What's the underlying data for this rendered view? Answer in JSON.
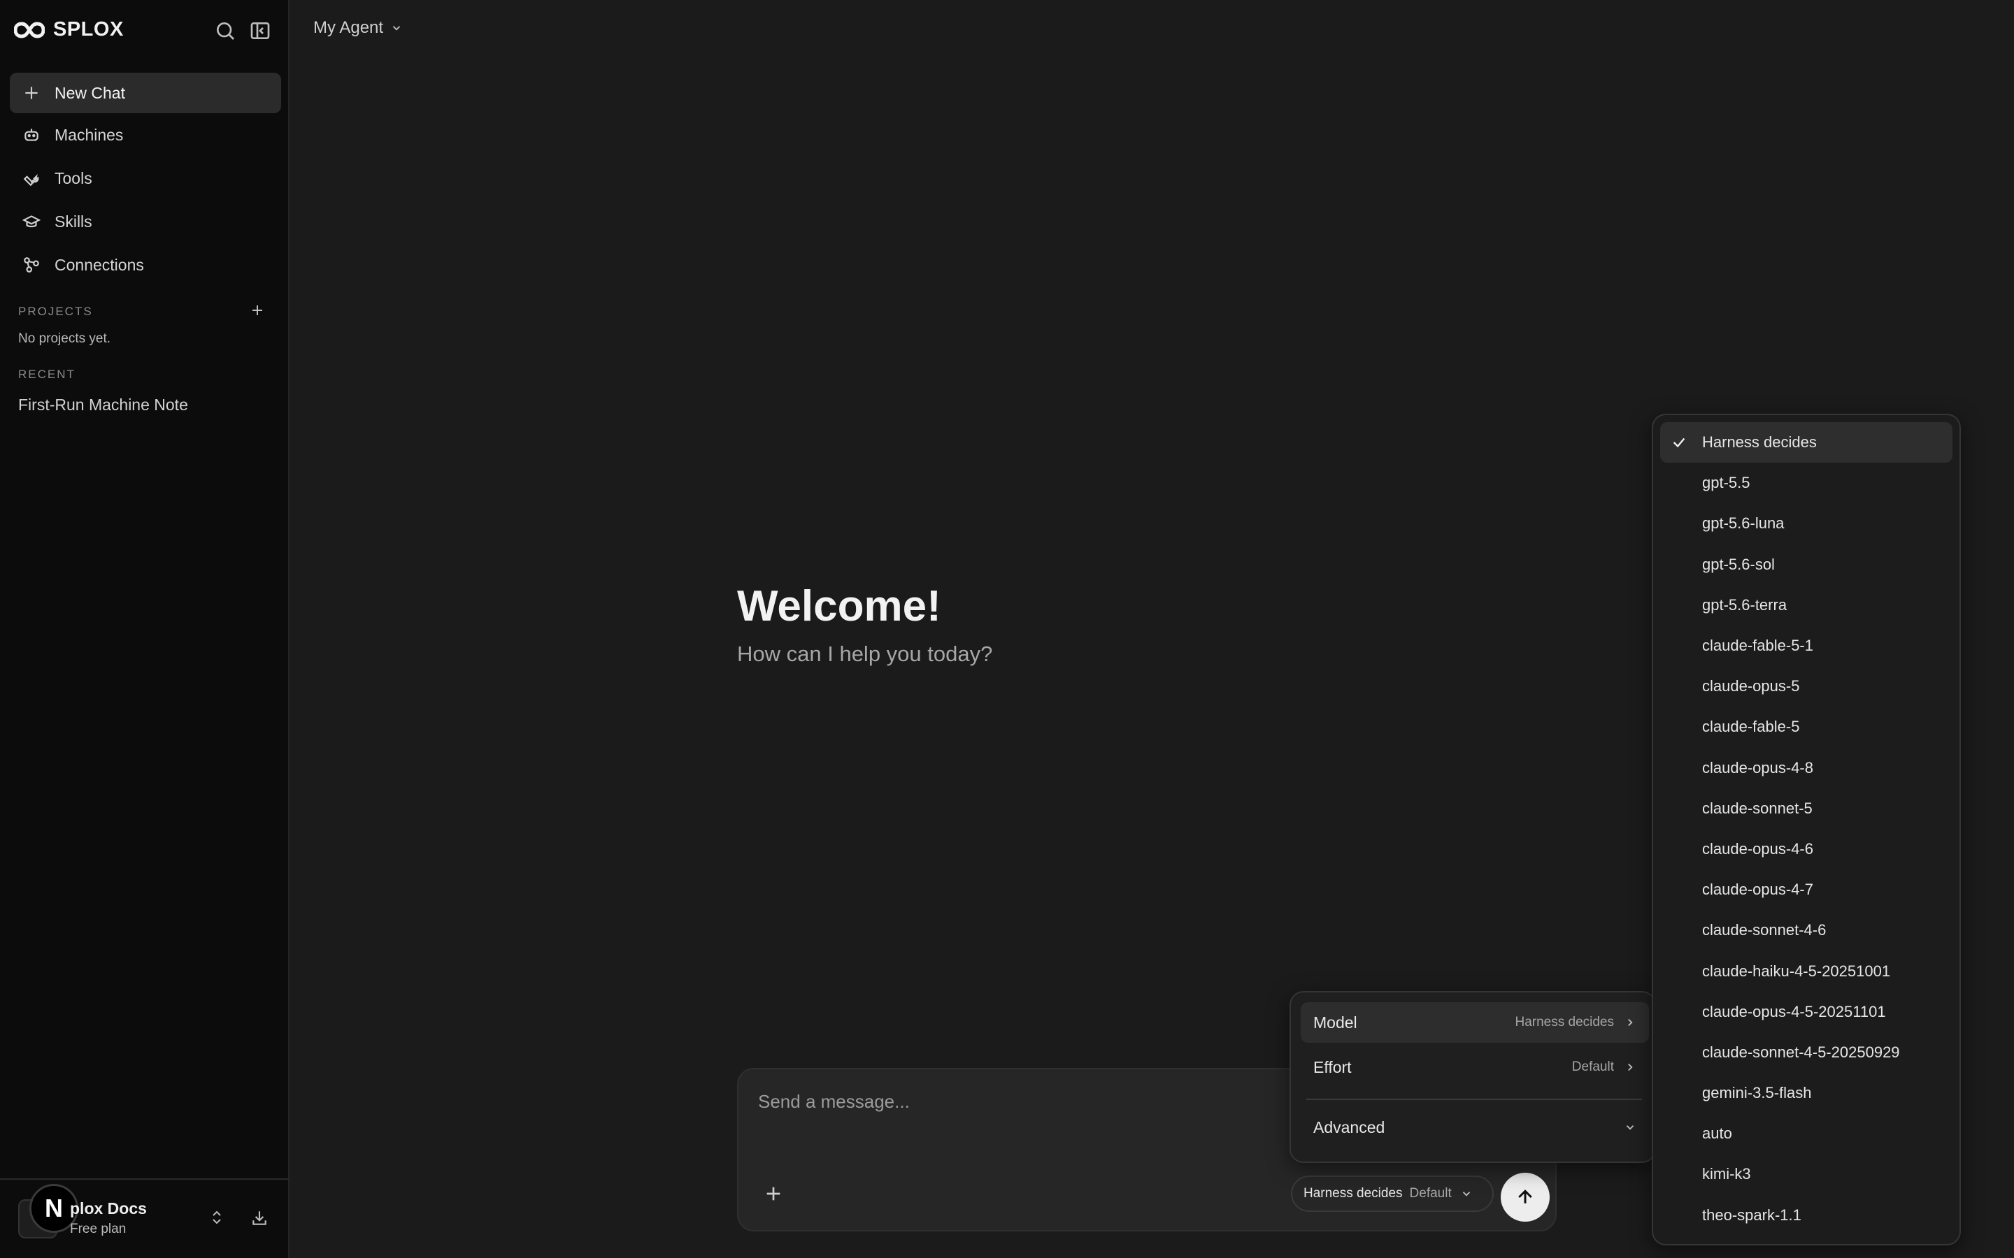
{
  "sidebar": {
    "brand": "SPLOX",
    "nav": [
      {
        "label": "New Chat"
      },
      {
        "label": "Machines"
      },
      {
        "label": "Tools"
      },
      {
        "label": "Skills"
      },
      {
        "label": "Connections"
      }
    ],
    "projects_label": "PROJECTS",
    "projects_empty": "No projects yet.",
    "recent_label": "RECENT",
    "recent_items": [
      "First-Run Machine Note"
    ],
    "workspace": {
      "avatar_letter": "N",
      "name": "plox Docs",
      "plan": "Free plan"
    }
  },
  "header": {
    "agent_label": "My Agent"
  },
  "welcome": {
    "title": "Welcome!",
    "subtitle": "How can I help you today?"
  },
  "composer": {
    "placeholder": "Send a message...",
    "model_pill": {
      "model": "Harness decides",
      "effort": "Default"
    }
  },
  "settings_popover": {
    "rows": [
      {
        "label": "Model",
        "value": "Harness decides"
      },
      {
        "label": "Effort",
        "value": "Default"
      }
    ],
    "advanced_label": "Advanced"
  },
  "model_menu": {
    "selected": "Harness decides",
    "options": [
      "Harness decides",
      "gpt-5.5",
      "gpt-5.6-luna",
      "gpt-5.6-sol",
      "gpt-5.6-terra",
      "claude-fable-5-1",
      "claude-opus-5",
      "claude-fable-5",
      "claude-opus-4-8",
      "claude-sonnet-5",
      "claude-opus-4-6",
      "claude-opus-4-7",
      "claude-sonnet-4-6",
      "claude-haiku-4-5-20251001",
      "claude-opus-4-5-20251101",
      "claude-sonnet-4-5-20250929",
      "gemini-3.5-flash",
      "auto",
      "kimi-k3",
      "theo-spark-1.1"
    ]
  },
  "colors": {
    "background": "#1b1b1b",
    "sidebar": "#0c0c0c",
    "accent_send": "#ededed"
  }
}
